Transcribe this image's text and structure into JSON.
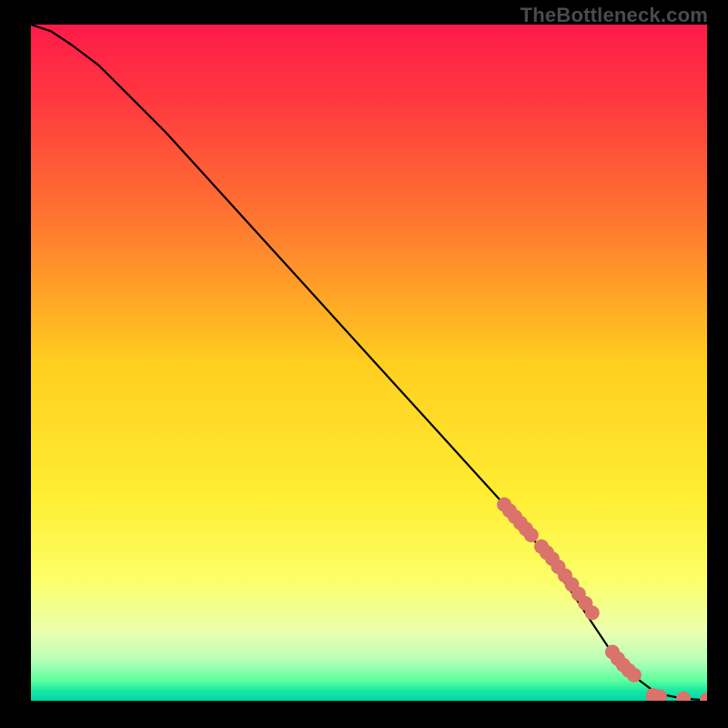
{
  "watermark": "TheBottleneck.com",
  "gradient": {
    "stops": [
      {
        "offset": 0.0,
        "color": "#ff1a49"
      },
      {
        "offset": 0.12,
        "color": "#ff3b3f"
      },
      {
        "offset": 0.3,
        "color": "#ff7a2f"
      },
      {
        "offset": 0.5,
        "color": "#ffce1f"
      },
      {
        "offset": 0.7,
        "color": "#ffee33"
      },
      {
        "offset": 0.82,
        "color": "#fcff66"
      },
      {
        "offset": 0.9,
        "color": "#eaffb0"
      },
      {
        "offset": 0.94,
        "color": "#b7ffb7"
      },
      {
        "offset": 0.97,
        "color": "#5effa0"
      },
      {
        "offset": 0.985,
        "color": "#18e9a0"
      },
      {
        "offset": 1.0,
        "color": "#00d6a9"
      }
    ]
  },
  "chart_data": {
    "type": "line",
    "title": "",
    "xlabel": "",
    "ylabel": "",
    "xlim": [
      0,
      100
    ],
    "ylim": [
      0,
      100
    ],
    "series": [
      {
        "name": "curve",
        "x": [
          0,
          3,
          6,
          10,
          15,
          20,
          30,
          40,
          50,
          60,
          70,
          75,
          80,
          84,
          86,
          88,
          90,
          92,
          94,
          96,
          98,
          100
        ],
        "y": [
          100,
          99,
          97,
          94,
          89,
          84,
          73,
          62,
          51,
          40,
          29,
          23,
          16,
          10,
          7,
          5,
          3,
          1.5,
          0.8,
          0.4,
          0.2,
          0.1
        ]
      }
    ],
    "points": {
      "name": "markers",
      "color": "#d9736b",
      "radius_px": 8,
      "x": [
        70.0,
        70.8,
        71.6,
        72.4,
        73.2,
        74.0,
        75.5,
        76.3,
        77.1,
        78.0,
        79.0,
        80.0,
        81.0,
        82.0,
        83.0,
        86.0,
        86.8,
        87.6,
        88.4,
        89.2,
        92.0,
        93.0,
        96.5,
        100.0
      ],
      "y": [
        29.0,
        28.1,
        27.2,
        26.3,
        25.4,
        24.5,
        22.8,
        21.9,
        21.0,
        19.8,
        18.5,
        17.2,
        15.8,
        14.4,
        13.0,
        7.2,
        6.2,
        5.3,
        4.5,
        3.8,
        0.8,
        0.6,
        0.3,
        0.15
      ]
    }
  }
}
